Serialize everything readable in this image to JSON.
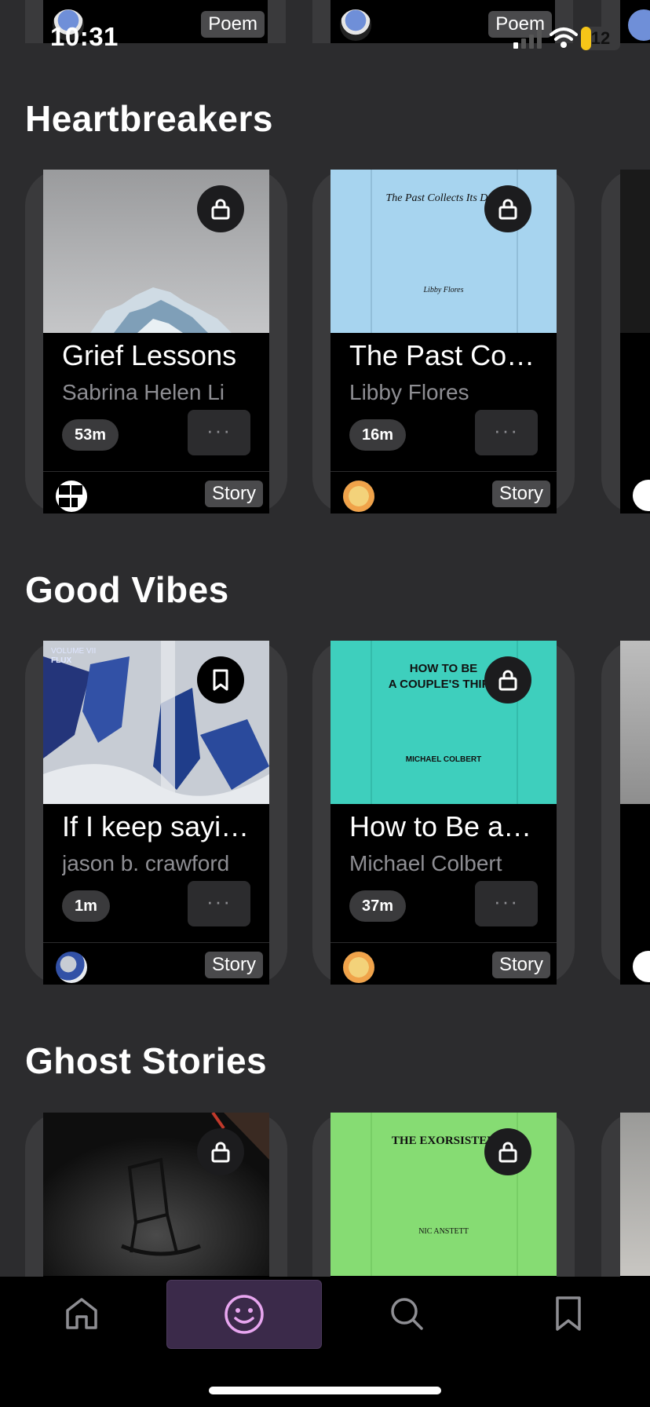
{
  "status_bar": {
    "time": "10:31",
    "battery_level": "12",
    "battery_fraction": 0.12,
    "battery_color": "#f5c518"
  },
  "top_row": {
    "cards": [
      {
        "tag": "Poem"
      },
      {
        "tag": "Poem"
      }
    ]
  },
  "sections": [
    {
      "title": "Heartbreakers",
      "cards": [
        {
          "title": "Grief Lessons",
          "author": "Sabrina Helen Li",
          "duration": "53m",
          "more": "···",
          "tag": "Story",
          "corner_icon": "lock-icon",
          "cover_text": []
        },
        {
          "title": "The Past Co…",
          "author": "Libby Flores",
          "duration": "16m",
          "more": "···",
          "tag": "Story",
          "corner_icon": "lock-icon",
          "cover_text": [
            "The Past Collects Its Debt",
            "Libby Flores"
          ]
        }
      ]
    },
    {
      "title": "Good Vibes",
      "cards": [
        {
          "title": "If I keep sayi…",
          "author": "jason b.  crawford",
          "duration": "1m",
          "more": "···",
          "tag": "Story",
          "corner_icon": "bookmark-icon",
          "cover_text": [
            "VOLUME VII",
            "FLUX"
          ]
        },
        {
          "title": "How to Be a…",
          "author": "Michael Colbert",
          "duration": "37m",
          "more": "···",
          "tag": "Story",
          "corner_icon": "lock-icon",
          "cover_text": [
            "HOW TO BE",
            "A COUPLE'S THIRD",
            "MICHAEL COLBERT"
          ]
        }
      ]
    },
    {
      "title": "Ghost Stories",
      "cards": [
        {
          "corner_icon": "lock-icon",
          "cover_text": []
        },
        {
          "corner_icon": "lock-icon",
          "cover_text": [
            "THE EXORSISTER",
            "NIC ANSTETT"
          ]
        }
      ]
    }
  ],
  "bottom_nav": {
    "items": [
      {
        "icon": "home-icon",
        "active": false
      },
      {
        "icon": "smiley-icon",
        "active": true
      },
      {
        "icon": "search-icon",
        "active": false
      },
      {
        "icon": "bookmark-icon",
        "active": false
      }
    ],
    "active_color": "#e8a6f0"
  },
  "colors": {
    "background": "#2c2c2e",
    "card_shell": "#3a3a3c",
    "cover_past": "#a7d4ef",
    "cover_couple": "#3ecfbd",
    "cover_exorsister": "#86dc73"
  }
}
